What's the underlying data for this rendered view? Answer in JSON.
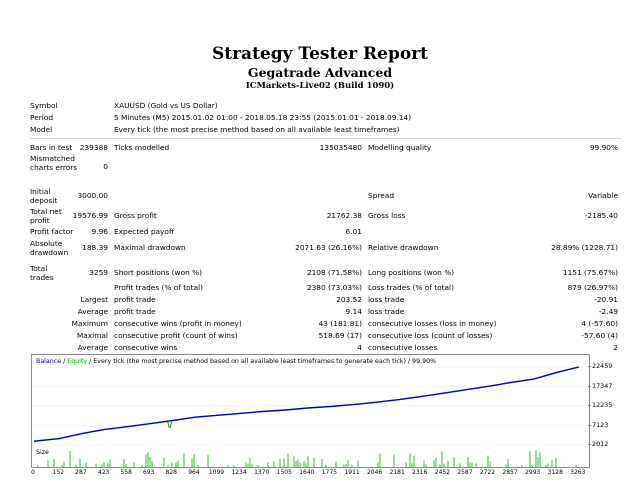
{
  "header": {
    "title": "Strategy Tester Report",
    "subtitle": "Gegatrade Advanced",
    "server": "ICMarkets-Live02 (Build 1090)"
  },
  "info": {
    "symbol_label": "Symbol",
    "symbol_value": "XAUUSD (Gold vs US Dollar)",
    "period_label": "Period",
    "period_value": "5 Minutes (M5) 2015.01.02 01:00 - 2018.05.18 23:55 (2015.01.01 - 2018.09.14)",
    "model_label": "Model",
    "model_value": "Every tick (the most precise method based on all available least timeframes)"
  },
  "stats": {
    "bars_label": "Bars in test",
    "bars_value": "239388",
    "ticks_label": "Ticks modelled",
    "ticks_value": "135035480",
    "quality_label": "Modelling quality",
    "quality_value": "99.90%",
    "mismatch_label": "Mismatched charts errors",
    "mismatch_value": "0",
    "deposit_label": "Initial deposit",
    "deposit_value": "3000.00",
    "spread_label": "Spread",
    "spread_value": "Variable",
    "netprofit_label": "Total net profit",
    "netprofit_value": "19576.99",
    "grossprofit_label": "Gross profit",
    "grossprofit_value": "21762.38",
    "grossloss_label": "Gross loss",
    "grossloss_value": "-2185.40",
    "pf_label": "Profit factor",
    "pf_value": "9.96",
    "ep_label": "Expected payoff",
    "ep_value": "6.01",
    "absdd_label": "Absolute drawdown",
    "absdd_value": "188.39",
    "maxdd_label": "Maximal drawdown",
    "maxdd_value": "2071.63 (26.16%)",
    "reldd_label": "Relative drawdown",
    "reldd_value": "28.89% (1228.71)",
    "trades_label": "Total trades",
    "trades_value": "3259",
    "short_label": "Short positions (won %)",
    "short_value": "2108 (71.58%)",
    "long_label": "Long positions (won %)",
    "long_value": "1151 (75.67%)",
    "pt_label": "Profit trades (% of total)",
    "pt_value": "2380 (73.03%)",
    "lt_label": "Loss trades (% of total)",
    "lt_value": "879 (26.97%)",
    "largest_label": "Largest",
    "largest_profit_label": "profit trade",
    "largest_profit_value": "203.52",
    "largest_loss_label": "loss trade",
    "largest_loss_value": "-20.91",
    "average_label": "Average",
    "average_profit_label": "profit trade",
    "average_profit_value": "9.14",
    "average_loss_label": "loss trade",
    "average_loss_value": "-2.49",
    "maximum_label": "Maximum",
    "max_wins_label": "consecutive wins (profit in money)",
    "max_wins_value": "43 (181.81)",
    "max_losses_label": "consecutive losses (loss in money)",
    "max_losses_value": "4 (-57.60)",
    "maximal_label": "Maximal",
    "maximal_profit_label": "consecutive profit (count of wins)",
    "maximal_profit_value": "518.69 (17)",
    "maximal_loss_label": "consecutive loss (count of losses)",
    "maximal_loss_value": "-57.60 (4)",
    "avgc_label": "Average",
    "avg_wins_label": "consecutive wins",
    "avg_wins_value": "4",
    "avg_losses_label": "consecutive losses",
    "avg_losses_value": "2"
  },
  "chart_legend": {
    "balance": "Balance",
    "sep1": " / ",
    "equity": "Equity",
    "rest": " / Every tick (the most precise method based on all available least timeframes to generate each tick) / 99.90%"
  },
  "chart_data": {
    "type": "line",
    "x_ticks": [
      "0",
      "152",
      "287",
      "423",
      "558",
      "693",
      "828",
      "964",
      "1099",
      "1234",
      "1370",
      "1505",
      "1640",
      "1775",
      "1911",
      "2046",
      "2181",
      "2316",
      "2452",
      "2587",
      "2722",
      "2857",
      "2993",
      "3128",
      "3263"
    ],
    "y_ticks": [
      "22459",
      "17347",
      "12235",
      "7123",
      "2012"
    ],
    "ylim": [
      2012,
      22459
    ],
    "xlim": [
      0,
      3300
    ],
    "colors": {
      "balance": "#0000c8",
      "equity": "#00aa00",
      "size": "#00aa00"
    },
    "series": [
      {
        "name": "Balance",
        "x": [
          0,
          152,
          287,
          423,
          558,
          693,
          828,
          964,
          1099,
          1234,
          1370,
          1505,
          1640,
          1775,
          1911,
          2046,
          2181,
          2316,
          2452,
          2587,
          2722,
          2857,
          2993,
          3128,
          3263
        ],
        "y": [
          3000,
          3700,
          5000,
          6100,
          6800,
          7600,
          8400,
          9300,
          9800,
          10300,
          10800,
          11200,
          11700,
          12100,
          12600,
          13200,
          13900,
          14700,
          15600,
          16500,
          17400,
          18400,
          19300,
          21000,
          22459
        ]
      },
      {
        "name": "Equity",
        "x": [
          0,
          152,
          287,
          423,
          558,
          693,
          800,
          808,
          815,
          822,
          828,
          964,
          1099,
          1234,
          1370,
          1505,
          1640,
          1775,
          1911,
          2046,
          2181,
          2316,
          2452,
          2587,
          2722,
          2857,
          2993,
          3128,
          3263
        ],
        "y": [
          3000,
          3700,
          5000,
          6100,
          6800,
          7600,
          8250,
          6700,
          6600,
          7700,
          8400,
          9300,
          9800,
          10300,
          10800,
          11200,
          11700,
          12100,
          12600,
          13200,
          13900,
          14700,
          15600,
          16500,
          17400,
          18400,
          19300,
          21000,
          22459
        ]
      }
    ],
    "size_label": "Size"
  }
}
